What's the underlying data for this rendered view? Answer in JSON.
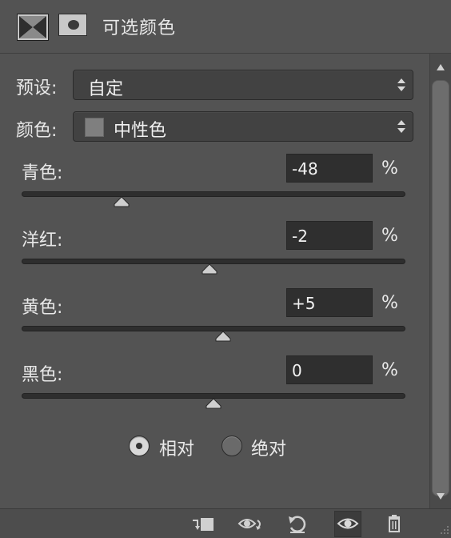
{
  "panel": {
    "title": "可选颜色",
    "adjustment_icon": "selective-color-icon",
    "mask_icon": "layer-mask-icon"
  },
  "presets": {
    "label": "预设:",
    "value": "自定"
  },
  "colors": {
    "label": "颜色:",
    "value": "中性色",
    "swatch_color": "#7f7f7f"
  },
  "sliders": [
    {
      "label": "青色:",
      "value": "-48",
      "unit": "%",
      "fraction": 0.26
    },
    {
      "label": "洋红:",
      "value": "-2",
      "unit": "%",
      "fraction": 0.49
    },
    {
      "label": "黄色:",
      "value": "+5",
      "unit": "%",
      "fraction": 0.525
    },
    {
      "label": "黑色:",
      "value": "0",
      "unit": "%",
      "fraction": 0.5
    }
  ],
  "method": {
    "relative_label": "相对",
    "absolute_label": "绝对",
    "selected": "relative"
  },
  "footer_icons": [
    "clip-to-layer-icon",
    "view-previous-state-icon",
    "reset-icon",
    "visibility-eye-icon",
    "trash-icon"
  ],
  "colors_theme": {
    "panel_bg": "#535353",
    "input_bg": "#2f2f2f",
    "text": "#e8e8e8"
  }
}
